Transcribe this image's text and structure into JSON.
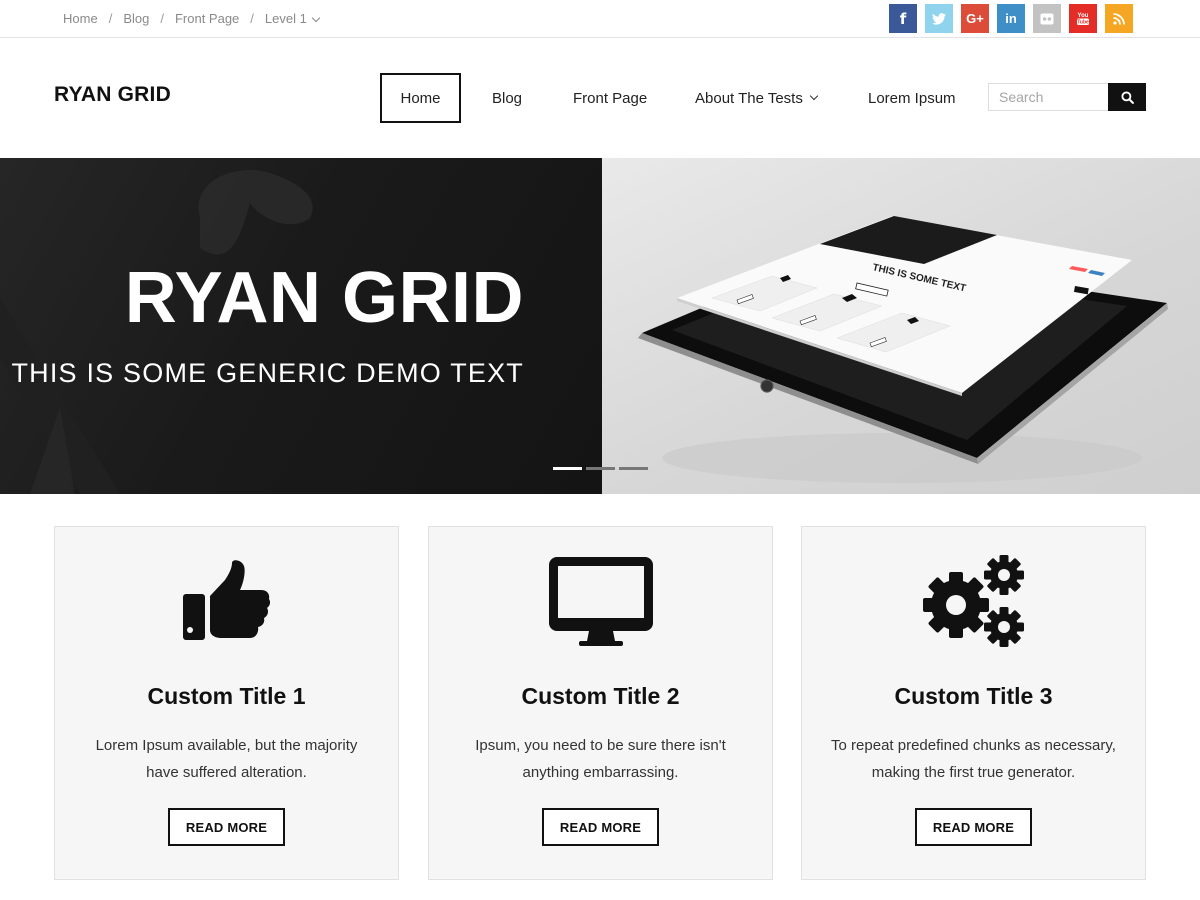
{
  "breadcrumb": {
    "items": [
      "Home",
      "Blog",
      "Front Page",
      "Level 1"
    ],
    "separator": "/"
  },
  "social": [
    {
      "name": "facebook",
      "glyph": "f",
      "color": "#3b5998"
    },
    {
      "name": "twitter",
      "glyph": "",
      "color": "#8fd3ec"
    },
    {
      "name": "google-plus",
      "glyph": "G+",
      "color": "#dd4b39"
    },
    {
      "name": "linkedin",
      "glyph": "in",
      "color": "#3e8fc8"
    },
    {
      "name": "flickr",
      "glyph": "",
      "color": "#c3c3c3"
    },
    {
      "name": "youtube",
      "glyph": "",
      "color": "#e52d27"
    },
    {
      "name": "rss",
      "glyph": "",
      "color": "#f5a623"
    }
  ],
  "header": {
    "logo": "RYAN GRID",
    "nav": [
      "Home",
      "Blog",
      "Front Page",
      "About The Tests",
      "Lorem Ipsum"
    ],
    "active": "Home",
    "search_placeholder": "Search"
  },
  "hero": {
    "title": "RYAN GRID",
    "subtitle": "THIS IS SOME GENERIC DEMO TEXT",
    "mockup_heading": "THIS IS SOME TEXT",
    "slides": 3,
    "active_slide": 1
  },
  "cards": [
    {
      "icon": "thumbs-up-icon",
      "title": "Custom Title 1",
      "line1": "Lorem Ipsum available, but the majority",
      "line2": "have suffered alteration.",
      "button": "READ MORE"
    },
    {
      "icon": "monitor-icon",
      "title": "Custom Title 2",
      "line1": "Ipsum, you need to be sure there isn't",
      "line2": "anything embarrassing.",
      "button": "READ MORE"
    },
    {
      "icon": "gears-icon",
      "title": "Custom Title 3",
      "line1": "To repeat predefined chunks as necessary,",
      "line2": "making the first true generator.",
      "button": "READ MORE"
    }
  ]
}
